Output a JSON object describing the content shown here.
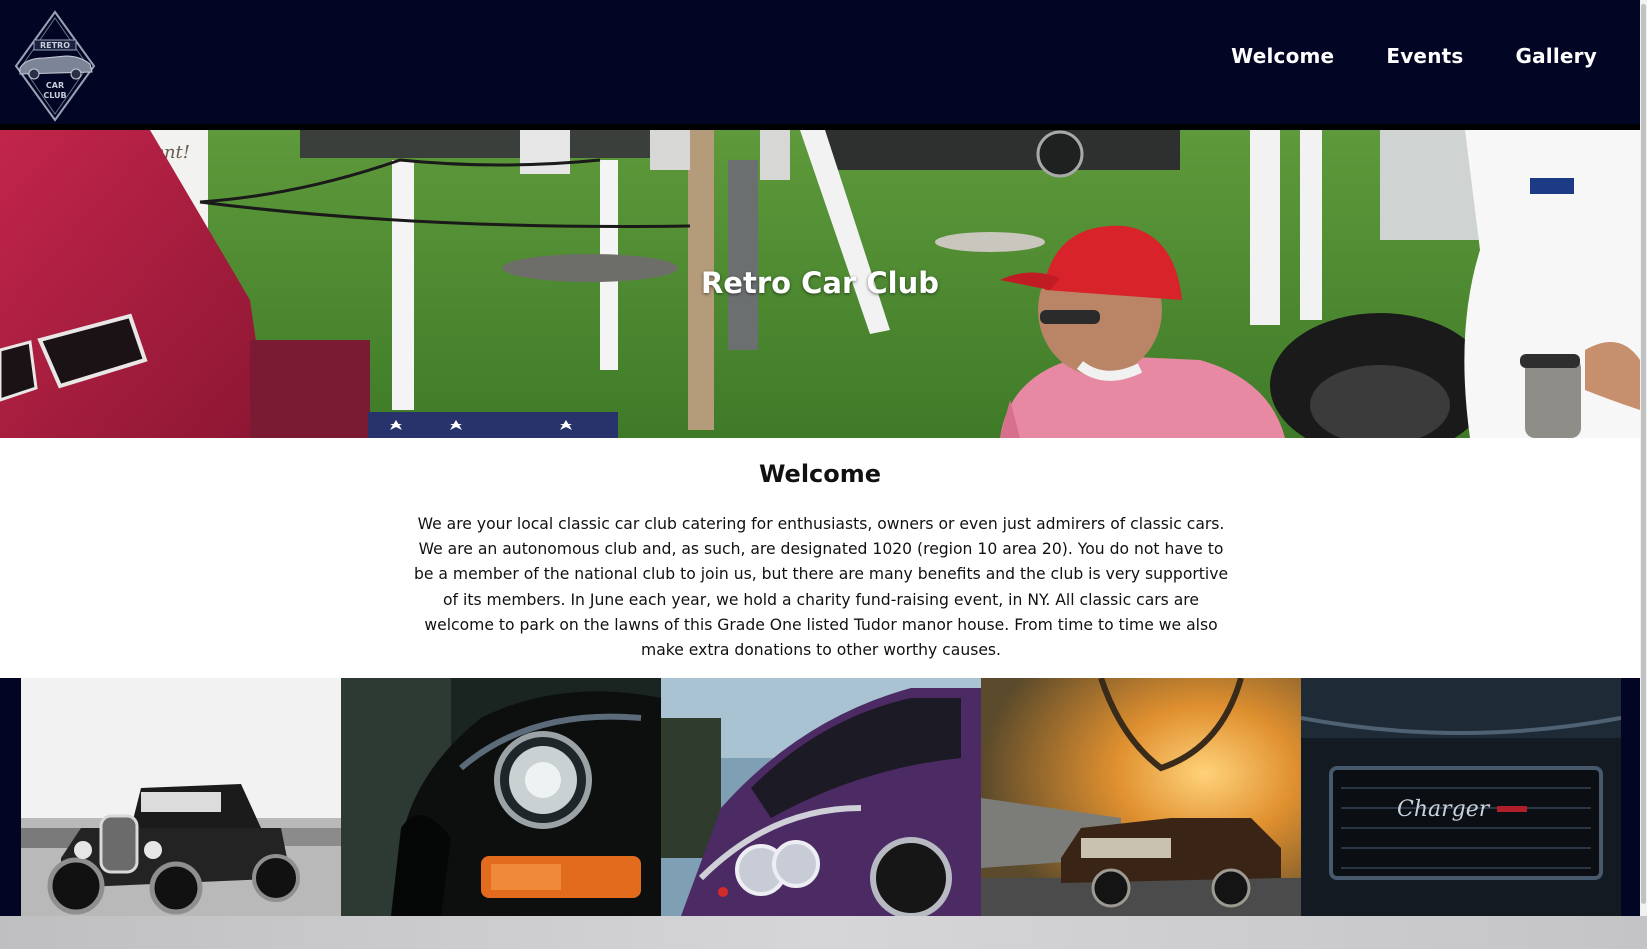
{
  "site": {
    "logo_text": [
      "RETRO",
      "CAR",
      "CLUB"
    ]
  },
  "nav": {
    "items": [
      {
        "label": "Welcome"
      },
      {
        "label": "Events"
      },
      {
        "label": "Gallery"
      }
    ]
  },
  "hero": {
    "title": "Retro Car Club",
    "sign_text": "Event!"
  },
  "welcome": {
    "heading": "Welcome",
    "body": "We are your local classic car club catering for enthusiasts, owners or even just admirers of classic cars. We are an autonomous club and, as such, are designated 1020 (region 10 area 20). You do not have to be a member of the national club to join us, but there are many benefits and the club is very supportive of its members. In June each year, we hold a charity fund-raising event, in NY. All classic cars are welcome to park on the lawns of this Grade One listed Tudor manor house. From time to time we also make extra donations to other worthy causes."
  },
  "gallery": {
    "images": [
      {
        "name": "black-white-hot-rod"
      },
      {
        "name": "black-porsche-headlight"
      },
      {
        "name": "purple-classic-car"
      },
      {
        "name": "sunset-classic-car"
      },
      {
        "name": "dodge-charger-grille",
        "badge": "Charger"
      }
    ]
  },
  "colors": {
    "header_bg": "#020524",
    "text_dark": "#111111",
    "nav_text": "#ffffff"
  }
}
